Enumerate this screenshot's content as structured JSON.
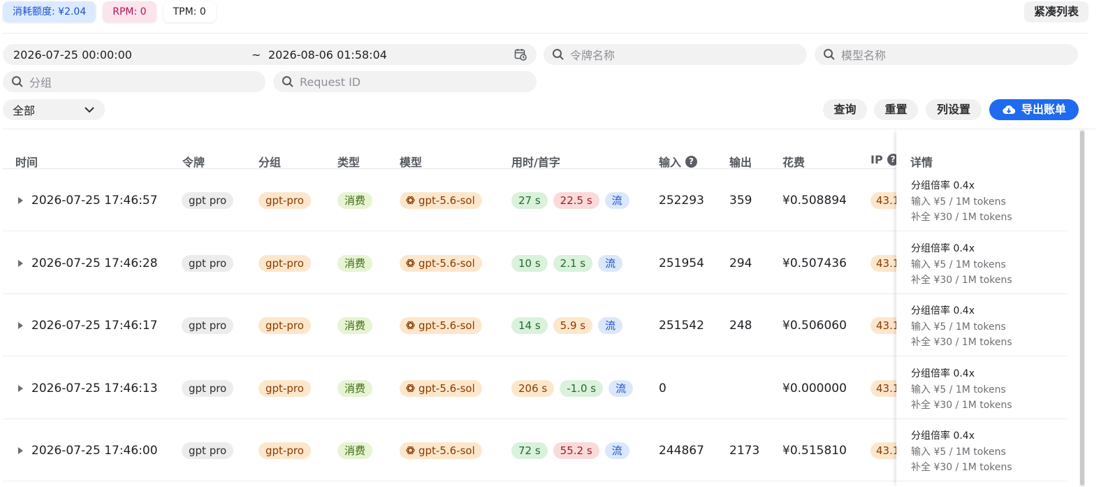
{
  "stats": {
    "quota": "消耗额度: ¥2.04",
    "rpm": "RPM: 0",
    "tpm": "TPM: 0"
  },
  "compact_list_label": "紧凑列表",
  "filters": {
    "start_time": "2026-07-25 00:00:00",
    "separator": "~",
    "end_time": "2026-08-06 01:58:04",
    "token_placeholder": "令牌名称",
    "model_placeholder": "模型名称",
    "group_placeholder": "分组",
    "request_id_placeholder": "Request ID",
    "type_select": "全部"
  },
  "actions": {
    "query": "查询",
    "reset": "重置",
    "column_settings": "列设置",
    "export": "导出账单"
  },
  "table": {
    "headers": {
      "time": "时间",
      "token": "令牌",
      "group": "分组",
      "type": "类型",
      "model": "模型",
      "duration": "用时/首字",
      "input": "输入",
      "output": "输出",
      "cost": "花费",
      "ip": "IP",
      "detail": "详情"
    },
    "rows": [
      {
        "time": "2026-07-25 17:46:57",
        "token": "gpt pro",
        "group": "gpt-pro",
        "type": "消费",
        "model": "gpt-5.6-sol",
        "duration": "27 s",
        "first_token": "22.5 s",
        "stream": "流",
        "input": "252293",
        "output": "359",
        "cost": "¥0.508894",
        "ip": "43.1",
        "detail_ratio": "分组倍率 0.4x",
        "detail_input": "输入 ¥5 / 1M tokens",
        "detail_completion": "补全 ¥30 / 1M tokens"
      },
      {
        "time": "2026-07-25 17:46:28",
        "token": "gpt pro",
        "group": "gpt-pro",
        "type": "消费",
        "model": "gpt-5.6-sol",
        "duration": "10 s",
        "first_token": "2.1 s",
        "stream": "流",
        "input": "251954",
        "output": "294",
        "cost": "¥0.507436",
        "ip": "43.1",
        "detail_ratio": "分组倍率 0.4x",
        "detail_input": "输入 ¥5 / 1M tokens",
        "detail_completion": "补全 ¥30 / 1M tokens"
      },
      {
        "time": "2026-07-25 17:46:17",
        "token": "gpt pro",
        "group": "gpt-pro",
        "type": "消费",
        "model": "gpt-5.6-sol",
        "duration": "14 s",
        "first_token": "5.9 s",
        "stream": "流",
        "input": "251542",
        "output": "248",
        "cost": "¥0.506060",
        "ip": "43.1",
        "detail_ratio": "分组倍率 0.4x",
        "detail_input": "输入 ¥5 / 1M tokens",
        "detail_completion": "补全 ¥30 / 1M tokens"
      },
      {
        "time": "2026-07-25 17:46:13",
        "token": "gpt pro",
        "group": "gpt-pro",
        "type": "消费",
        "model": "gpt-5.6-sol",
        "duration": "206 s",
        "first_token": "-1.0 s",
        "stream": "流",
        "input": "0",
        "output": "",
        "cost": "¥0.000000",
        "ip": "43.1",
        "detail_ratio": "分组倍率 0.4x",
        "detail_input": "输入 ¥5 / 1M tokens",
        "detail_completion": "补全 ¥30 / 1M tokens"
      },
      {
        "time": "2026-07-25 17:46:00",
        "token": "gpt pro",
        "group": "gpt-pro",
        "type": "消费",
        "model": "gpt-5.6-sol",
        "duration": "72 s",
        "first_token": "55.2 s",
        "stream": "流",
        "input": "244867",
        "output": "2173",
        "cost": "¥0.515810",
        "ip": "43.1",
        "detail_ratio": "分组倍率 0.4x",
        "detail_input": "输入 ¥5 / 1M tokens",
        "detail_completion": "补全 ¥30 / 1M tokens"
      }
    ]
  },
  "colors": {
    "primary": "#1f6bef",
    "duration_colors": [
      "mint",
      "mint",
      "mint",
      "orange",
      "mint"
    ],
    "first_token_colors": [
      "red",
      "mint",
      "orange",
      "mint",
      "red"
    ]
  },
  "icons": {
    "search": "search-icon",
    "calendar": "calendar-icon",
    "chevron": "chevron-down-icon",
    "cloud": "cloud-download-icon",
    "help": "help-icon",
    "expand": "expand-caret-icon",
    "model": "openai-icon"
  }
}
